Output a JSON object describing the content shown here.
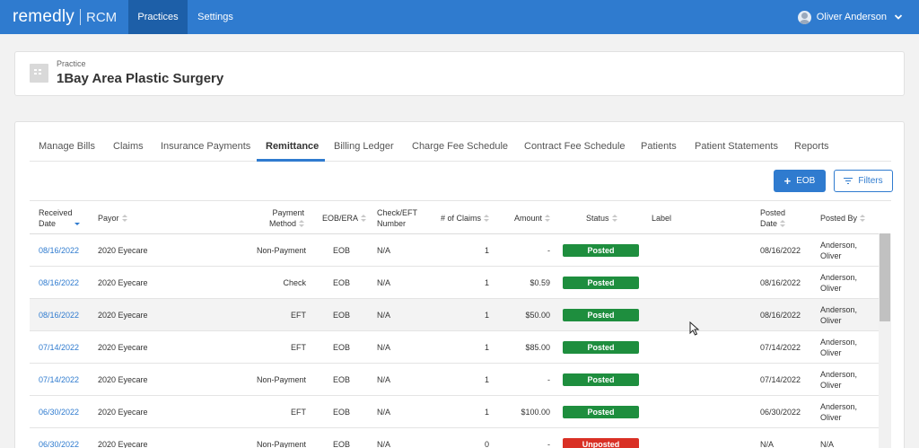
{
  "app": {
    "logo_word": "remedly",
    "logo_suffix": "RCM",
    "nav": [
      {
        "label": "Practices",
        "active": true
      },
      {
        "label": "Settings",
        "active": false
      }
    ],
    "user_name": "Oliver Anderson"
  },
  "practice": {
    "label": "Practice",
    "name": "1Bay Area Plastic Surgery"
  },
  "tabs": [
    {
      "label": "Manage Bills"
    },
    {
      "label": "Claims"
    },
    {
      "label": "Insurance Payments"
    },
    {
      "label": "Remittance",
      "active": true
    },
    {
      "label": "Billing Ledger"
    },
    {
      "label": "Charge Fee Schedule"
    },
    {
      "label": "Contract Fee Schedule"
    },
    {
      "label": "Patients"
    },
    {
      "label": "Patient Statements"
    },
    {
      "label": "Reports"
    }
  ],
  "toolbar": {
    "eob_label": "EOB",
    "filters_label": "Filters"
  },
  "table": {
    "headers": {
      "received_date_1": "Received",
      "received_date_2": "Date",
      "payor": "Payor",
      "payment_method_1": "Payment",
      "payment_method_2": "Method",
      "eob_era": "EOB/ERA",
      "check_eft_1": "Check/EFT",
      "check_eft_2": "Number",
      "num_claims": "# of Claims",
      "amount": "Amount",
      "status": "Status",
      "label": "Label",
      "posted_date_1": "Posted",
      "posted_date_2": "Date",
      "posted_by": "Posted By"
    },
    "rows": [
      {
        "received": "08/16/2022",
        "payor": "2020 Eyecare",
        "method": "Non-Payment",
        "eob": "EOB",
        "check": "N/A",
        "claims": "1",
        "amount": "-",
        "status": "Posted",
        "posted_date": "08/16/2022",
        "posted_by_1": "Anderson,",
        "posted_by_2": "Oliver"
      },
      {
        "received": "08/16/2022",
        "payor": "2020 Eyecare",
        "method": "Check",
        "eob": "EOB",
        "check": "N/A",
        "claims": "1",
        "amount": "$0.59",
        "status": "Posted",
        "posted_date": "08/16/2022",
        "posted_by_1": "Anderson,",
        "posted_by_2": "Oliver"
      },
      {
        "received": "08/16/2022",
        "payor": "2020 Eyecare",
        "method": "EFT",
        "eob": "EOB",
        "check": "N/A",
        "claims": "1",
        "amount": "$50.00",
        "status": "Posted",
        "posted_date": "08/16/2022",
        "posted_by_1": "Anderson,",
        "posted_by_2": "Oliver"
      },
      {
        "received": "07/14/2022",
        "payor": "2020 Eyecare",
        "method": "EFT",
        "eob": "EOB",
        "check": "N/A",
        "claims": "1",
        "amount": "$85.00",
        "status": "Posted",
        "posted_date": "07/14/2022",
        "posted_by_1": "Anderson,",
        "posted_by_2": "Oliver"
      },
      {
        "received": "07/14/2022",
        "payor": "2020 Eyecare",
        "method": "Non-Payment",
        "eob": "EOB",
        "check": "N/A",
        "claims": "1",
        "amount": "-",
        "status": "Posted",
        "posted_date": "07/14/2022",
        "posted_by_1": "Anderson,",
        "posted_by_2": "Oliver"
      },
      {
        "received": "06/30/2022",
        "payor": "2020 Eyecare",
        "method": "EFT",
        "eob": "EOB",
        "check": "N/A",
        "claims": "1",
        "amount": "$100.00",
        "status": "Posted",
        "posted_date": "06/30/2022",
        "posted_by_1": "Anderson,",
        "posted_by_2": "Oliver"
      },
      {
        "received": "06/30/2022",
        "payor": "2020 Eyecare",
        "method": "Non-Payment",
        "eob": "EOB",
        "check": "N/A",
        "claims": "0",
        "amount": "-",
        "status": "Unposted",
        "posted_date": "N/A",
        "posted_by_1": "N/A",
        "posted_by_2": ""
      }
    ]
  },
  "colors": {
    "brand_blue": "#2f7bcf",
    "nav_active": "#1d5fa8",
    "posted_green": "#1e8e3e",
    "unposted_red": "#d93025"
  },
  "icons": [
    "avatar-icon",
    "chevron-down-icon",
    "practice-building-icon",
    "plus-icon",
    "filter-icon",
    "sort-icon",
    "mouse-cursor-icon"
  ]
}
